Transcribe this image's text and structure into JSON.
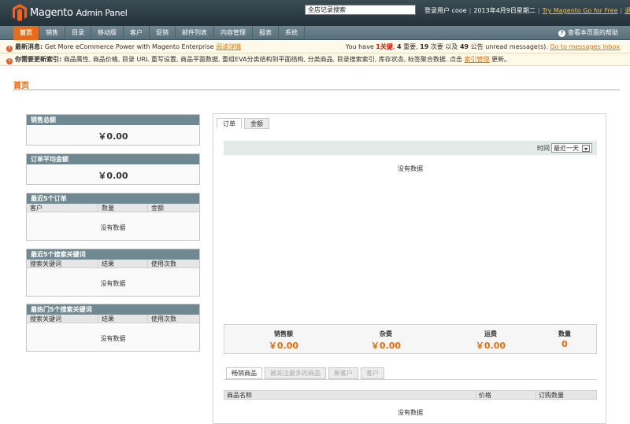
{
  "header": {
    "logo_main": "Magento",
    "logo_sub": "Admin Panel",
    "search_value": "全店记录搜索",
    "logged_in": "登录用户 cooe",
    "date": "2013年4月9日星期二",
    "try_link": "Try Magento Go for Free",
    "logout": "退出"
  },
  "nav": {
    "items": [
      "首页",
      "销售",
      "目录",
      "移动版",
      "客户",
      "促销",
      "邮件列表",
      "内容管理",
      "报表",
      "系统"
    ],
    "help": "查看本页面的帮助"
  },
  "notice1": {
    "label": "最新消息:",
    "text": "Get More eCommerce Power with Magento Enterprise",
    "link": "阅读详情",
    "right_prefix": "You have",
    "critical_count": "1",
    "critical_label": "关键",
    "major_count": "4",
    "major_label": "重要",
    "minor_count": "19",
    "minor_label": "次要 以及",
    "notice_count": "49",
    "notice_label": "公告 unread message(s).",
    "inbox_link": "Go to messages inbox"
  },
  "notice2": {
    "label": "你需要更新索引:",
    "text": "商品属性, 商品价格, 目录 URL 重写设置, 商品平面数据, 重组EVA分类结构到平面结构, 分类商品, 目录搜索索引, 库存状态, 标签聚合数据. 点击",
    "link": "索引管理",
    "suffix": "更新。"
  },
  "page": {
    "title": "首页"
  },
  "left": {
    "sales_total": {
      "title": "销售总额",
      "value": "￥0.00"
    },
    "avg_order": {
      "title": "订单平均金额",
      "value": "￥0.00"
    },
    "last_orders": {
      "title": "最近5个订单",
      "columns": [
        "客户",
        "数量",
        "金额"
      ],
      "empty": "没有数据"
    },
    "last_search": {
      "title": "最近5个搜索关键词",
      "columns": [
        "搜索关键词",
        "结果",
        "使用次数"
      ],
      "empty": "没有数据"
    },
    "top_search": {
      "title": "最热门5个搜索关键词",
      "columns": [
        "搜索关键词",
        "结果",
        "使用次数"
      ],
      "empty": "没有数据"
    }
  },
  "right": {
    "tabs": [
      "订单",
      "金额"
    ],
    "range_label": "时间",
    "range_value": "最近一天",
    "chart_empty": "没有数据",
    "totals": [
      {
        "label": "销售额",
        "value": "￥0.00"
      },
      {
        "label": "杂费",
        "value": "￥0.00"
      },
      {
        "label": "运费",
        "value": "￥0.00"
      },
      {
        "label": "数量",
        "value": "0"
      }
    ],
    "grid_tabs": [
      "畅销商品",
      "被关注最多的商品",
      "新客户",
      "客户"
    ],
    "grid_columns": [
      "商品名称",
      "价格",
      "订购数量"
    ],
    "grid_empty": "没有数据"
  },
  "colors": {
    "accent": "#eb5e00",
    "nav_active": "#e96a17",
    "box_head": "#6f8992"
  }
}
